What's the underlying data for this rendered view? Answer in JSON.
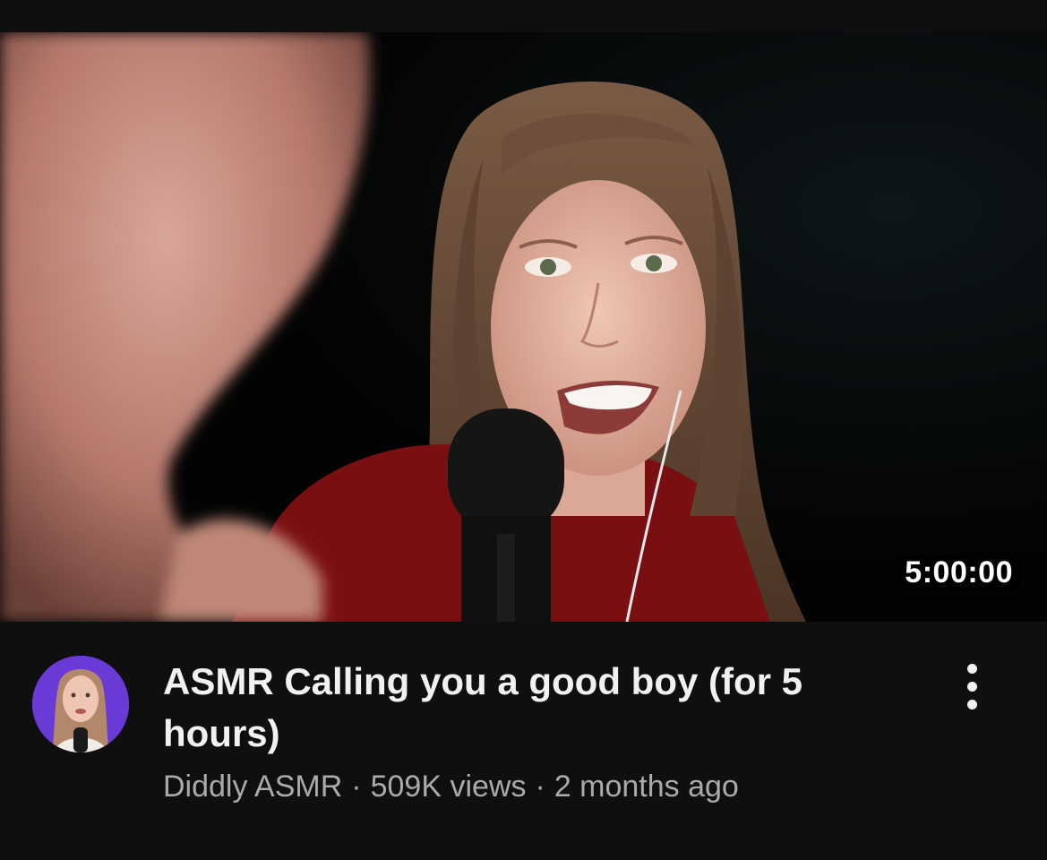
{
  "video": {
    "duration": "5:00:00",
    "title": "ASMR Calling you a good boy (for 5 hours)",
    "channel": "Diddly ASMR",
    "separator": "·",
    "views": "509K views",
    "age": "2 months ago"
  },
  "icons": {
    "more": "more-vert-icon"
  },
  "colors": {
    "background": "#0f0f0f",
    "title_text": "#f1f1f1",
    "secondary_text": "#aaaaaa",
    "avatar_bg": "#6a3ad6",
    "shirt_red": "#7a0f12"
  }
}
